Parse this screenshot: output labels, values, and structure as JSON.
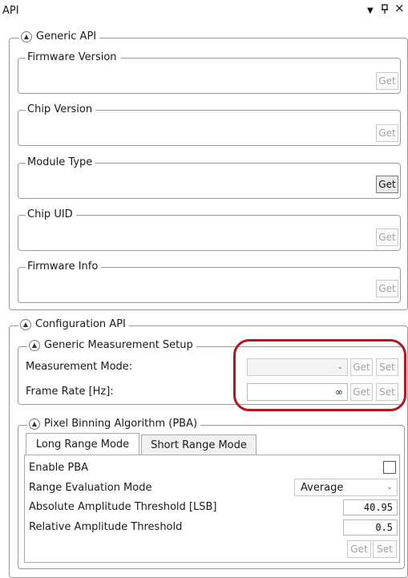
{
  "pane": {
    "title": "API",
    "dropdown_glyph": "▼",
    "pin_glyph": "q",
    "close_glyph": "×"
  },
  "generic_api": {
    "title": "Generic API",
    "get_label": "Get",
    "items": [
      {
        "label": "Firmware Version",
        "value": ""
      },
      {
        "label": "Chip Version",
        "value": ""
      },
      {
        "label": "Module Type",
        "value": ""
      },
      {
        "label": "Chip UID",
        "value": ""
      },
      {
        "label": "Firmware Info",
        "value": ""
      }
    ]
  },
  "configuration_api": {
    "title": "Configuration API",
    "measurement_setup": {
      "title": "Generic Measurement Setup",
      "measurement_mode_label": "Measurement Mode:",
      "measurement_mode_value": "",
      "frame_rate_label": "Frame Rate [Hz]:",
      "frame_rate_value": "∞",
      "get_label": "Get",
      "set_label": "Set"
    },
    "pba": {
      "title": "Pixel Binning Algorithm (PBA)",
      "tabs": [
        "Long Range Mode",
        "Short Range Mode"
      ],
      "enable_label": "Enable PBA",
      "enable_checked": false,
      "range_eval_label": "Range Evaluation Mode",
      "range_eval_value": "Average",
      "abs_threshold_label": "Absolute Amplitude Threshold [LSB]",
      "abs_threshold_value": "40.95",
      "rel_threshold_label": "Relative Amplitude Threshold",
      "rel_threshold_value": "0.5",
      "get_label": "Get",
      "set_label": "Set"
    }
  },
  "colors": {
    "highlight": "#b3161c",
    "border": "#9a9a9a",
    "disabled_text": "#a3a3a3"
  }
}
